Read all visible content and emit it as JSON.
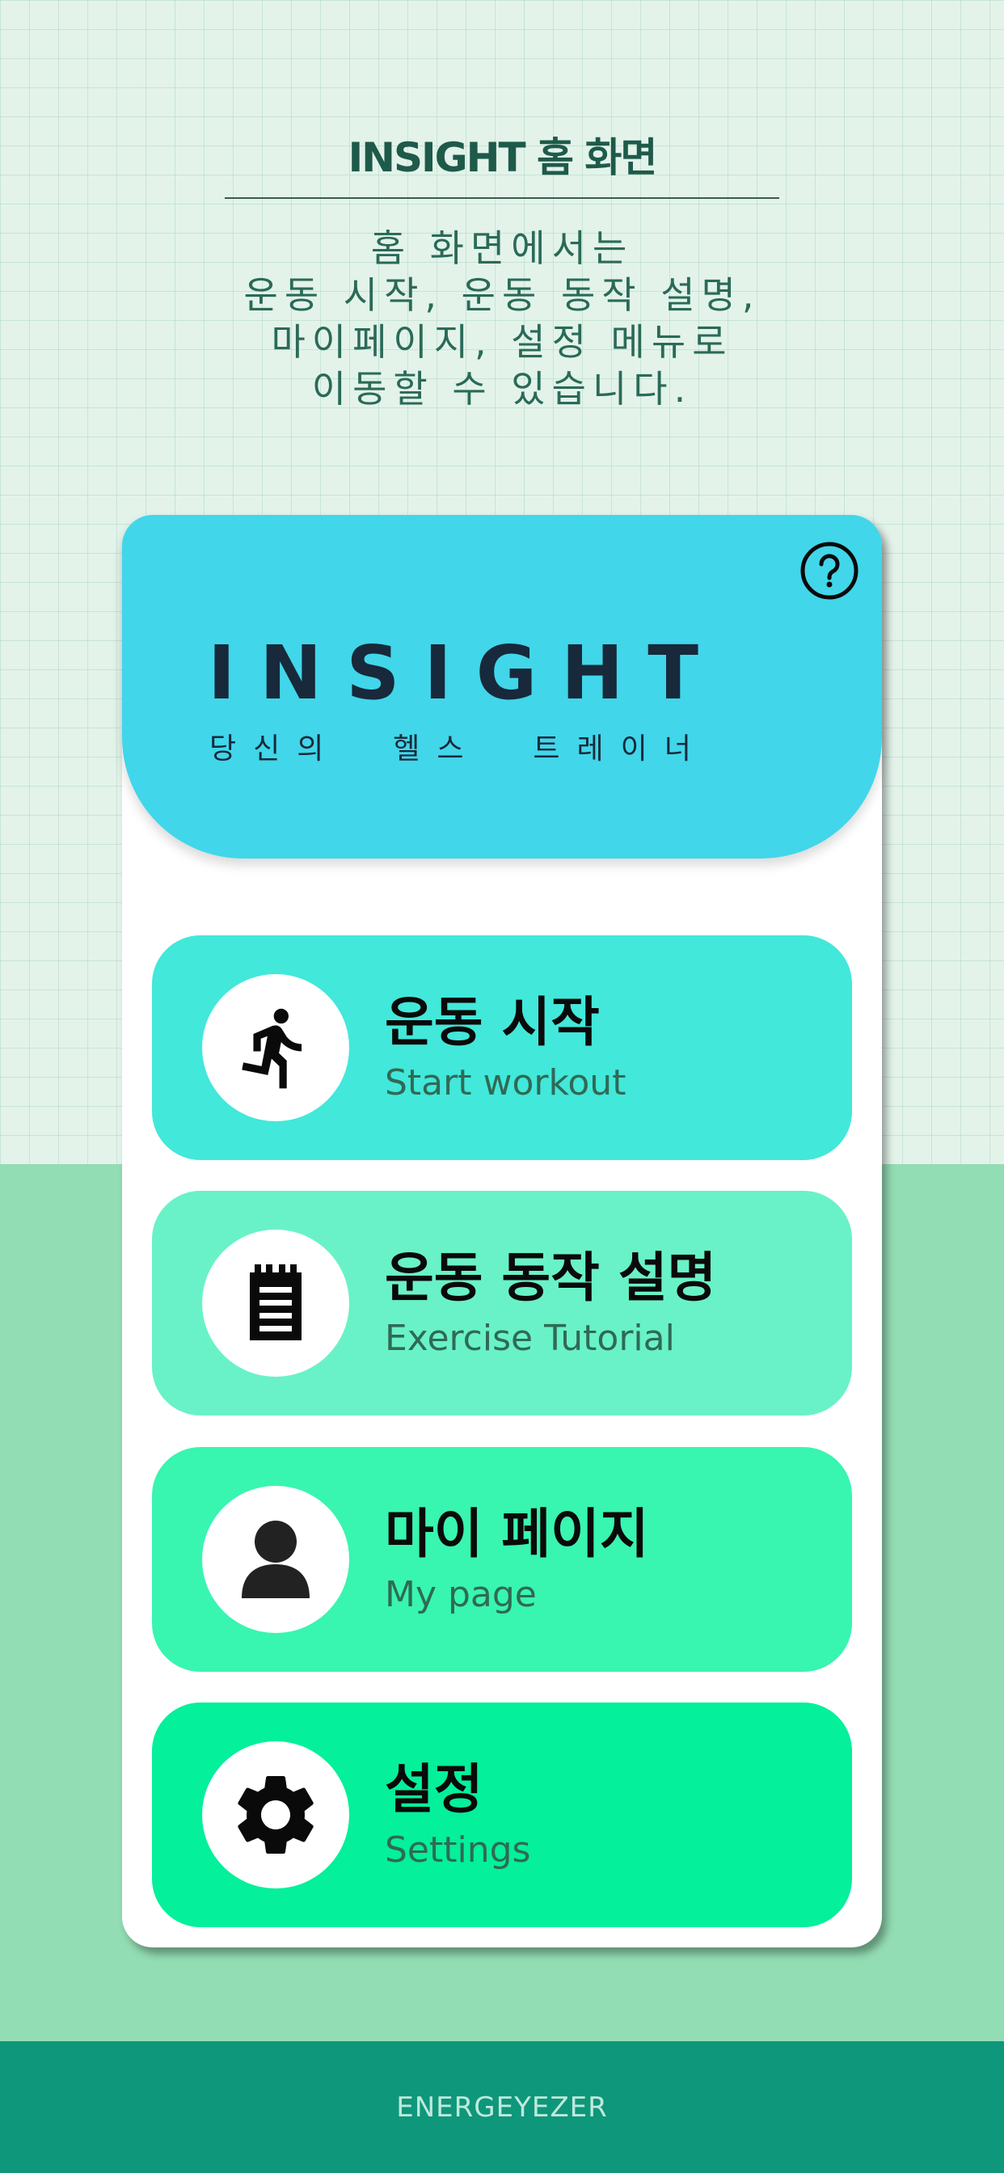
{
  "intro": {
    "title": "INSIGHT 홈 화면",
    "description": "홈 화면에서는\n운동 시작, 운동 동작 설명,\n마이페이지, 설정 메뉴로\n이동할 수 있습니다."
  },
  "hero": {
    "brand": "INSIGHT",
    "tagline": "당신의  헬스  트레이너",
    "help_icon": "question-circle-icon"
  },
  "menu": [
    {
      "title": "운동 시작",
      "subtitle": "Start workout",
      "icon": "running-person-icon",
      "color": "#42e8da"
    },
    {
      "title": "운동 동작 설명",
      "subtitle": "Exercise Tutorial",
      "icon": "notepad-icon",
      "color": "#69f2c7"
    },
    {
      "title": "마이 페이지",
      "subtitle": "My page",
      "icon": "person-icon",
      "color": "#38f5b0"
    },
    {
      "title": "설정",
      "subtitle": "Settings",
      "icon": "gear-icon",
      "color": "#04f09b"
    }
  ],
  "footer": {
    "label": "ENERGEYEZER"
  },
  "colors": {
    "hero": "#41d6ea",
    "footer": "#0e977a",
    "lower_background": "#93ddb4"
  }
}
